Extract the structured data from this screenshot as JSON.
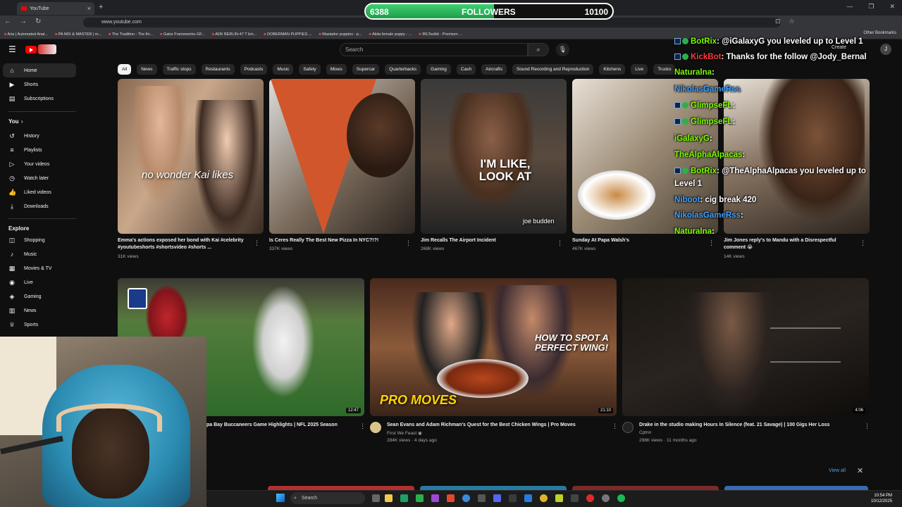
{
  "browser": {
    "tab_title": "YouTube",
    "url": "www.youtube.com",
    "bookmarks": [
      "Aria | Automated Anal...",
      "PA MIX & MASTER | m...",
      "The Tradition - The fin...",
      "Gator Frameworks GF...",
      "ADK BERLIN-47 T b/o...",
      "DOBERMAN PUPPIES ...",
      "Mastador puppies - p...",
      "Akita female puppy - ...",
      "IRLToolkit - Premium ..."
    ],
    "other_bookmarks": "Other Bookmarks"
  },
  "followers_bar": {
    "current": "6388",
    "label": "FOLLOWERS",
    "goal": "10100",
    "progress": 0.52,
    "fill_color": "#2db85a"
  },
  "header": {
    "search_placeholder": "Search",
    "create_label": "Create",
    "avatar_letter": "J"
  },
  "sidebar": {
    "main": [
      {
        "label": "Home",
        "icon": "home-icon"
      },
      {
        "label": "Shorts",
        "icon": "shorts-icon"
      },
      {
        "label": "Subscriptions",
        "icon": "subscriptions-icon"
      }
    ],
    "you_heading": "You",
    "you_items": [
      {
        "label": "History",
        "icon": "history-icon"
      },
      {
        "label": "Playlists",
        "icon": "playlists-icon"
      },
      {
        "label": "Your videos",
        "icon": "your-videos-icon"
      },
      {
        "label": "Watch later",
        "icon": "clock-icon"
      },
      {
        "label": "Liked videos",
        "icon": "thumbs-up-icon"
      },
      {
        "label": "Downloads",
        "icon": "download-icon"
      }
    ],
    "explore_heading": "Explore",
    "explore_items": [
      {
        "label": "Shopping",
        "icon": "bag-icon"
      },
      {
        "label": "Music",
        "icon": "music-icon"
      },
      {
        "label": "Movies & TV",
        "icon": "film-icon"
      },
      {
        "label": "Live",
        "icon": "live-icon"
      },
      {
        "label": "Gaming",
        "icon": "gaming-icon"
      },
      {
        "label": "News",
        "icon": "news-icon"
      },
      {
        "label": "Sports",
        "icon": "trophy-icon"
      }
    ]
  },
  "chips": [
    "All",
    "News",
    "Traffic stops",
    "Restaurants",
    "Podcasts",
    "Music",
    "Safety",
    "Mixes",
    "Supercar",
    "Quarterbacks",
    "Gaming",
    "Cash",
    "Aircrafts",
    "Sound Recording and Reproduction",
    "Kitchens",
    "Live",
    "Trucks"
  ],
  "shorts": [
    {
      "title": "Emma's actions exposed her bond with Kai #celebrity #youtubeshorts #shortsvideo #shorts ...",
      "views": "31K views",
      "overlay": "no wonder Kai likes"
    },
    {
      "title": "Is Ceres Really The Best New Pizza In NYC?!?!",
      "views": "337K views",
      "overlay": ""
    },
    {
      "title": "Jim Recalls The Airport Incident",
      "views": "268K views",
      "overlay": "I'M LIKE, LOOK AT",
      "overlay2": "joe budden"
    },
    {
      "title": "Sunday At Papa Walsh's",
      "views": "467K views",
      "overlay": ""
    },
    {
      "title": "Jim Jones reply's to Mandu with a Disrespectful comment 😭",
      "views": "14K views",
      "overlay": ""
    }
  ],
  "videos": [
    {
      "title": "pa Bay Buccaneers Game Highlights | NFL 2025 Season",
      "duration": "12:47",
      "channel": "",
      "meta": ""
    },
    {
      "title": "Sean Evans and Adam Richman's Quest for the Best Chicken Wings | Pro Moves",
      "duration": "21:10",
      "channel": "First We Feast",
      "meta": "284K views · 4 days ago",
      "overlay": "HOW TO SPOT A PERFECT WING!",
      "overlay2": "PRO MOVES"
    },
    {
      "title": "Drake in the studio making Hours In Silence (feat. 21 Savage) | 100 Gigs Her Loss",
      "duration": "4:06",
      "channel": "Cptnn",
      "meta": "298K views · 11 months ago"
    }
  ],
  "shelf": {
    "view_all": "View all"
  },
  "chat": [
    {
      "user": "BotRix",
      "color": "#7CFC00",
      "text": ": @iGalaxyG you leveled up to Level 1",
      "badges": true
    },
    {
      "user": "KickBot",
      "color": "#ff3b3b",
      "text": ": Thanks for the follow @Jody_Bernal",
      "badges": true
    },
    {
      "user": "Naturalna",
      "color": "#7CFC00",
      "text": ":",
      "badges": false
    },
    {
      "user": "NikolasGameRss",
      "color": "#3fa0ff",
      "text": "",
      "badges": false
    },
    {
      "user": "GlimpseFL",
      "color": "#7CFC00",
      "text": ":",
      "badges": true
    },
    {
      "user": "GlimpseFL",
      "color": "#7CFC00",
      "text": ":",
      "badges": true
    },
    {
      "user": "iGalaxyG",
      "color": "#7CFC00",
      "text": ":",
      "badges": false
    },
    {
      "user": "TheAlphaAlpacas",
      "color": "#7CFC00",
      "text": ":",
      "badges": false
    },
    {
      "user": "BotRix",
      "color": "#7CFC00",
      "text": ": @TheAlphaAlpacas you leveled up to",
      "badges": true
    },
    {
      "user": "",
      "color": "#ffffff",
      "text": "Level 1",
      "badges": false
    },
    {
      "user": "Niboot",
      "color": "#3fa0ff",
      "text": ": cig break 420",
      "badges": false
    },
    {
      "user": "NikolasGameRss",
      "color": "#3fa0ff",
      "text": ":",
      "badges": false
    },
    {
      "user": "Naturalna",
      "color": "#7CFC00",
      "text": ":",
      "badges": false
    }
  ],
  "taskbar": {
    "search_label": "Search",
    "time": "10:54 PM",
    "date": "10/12/2025"
  }
}
